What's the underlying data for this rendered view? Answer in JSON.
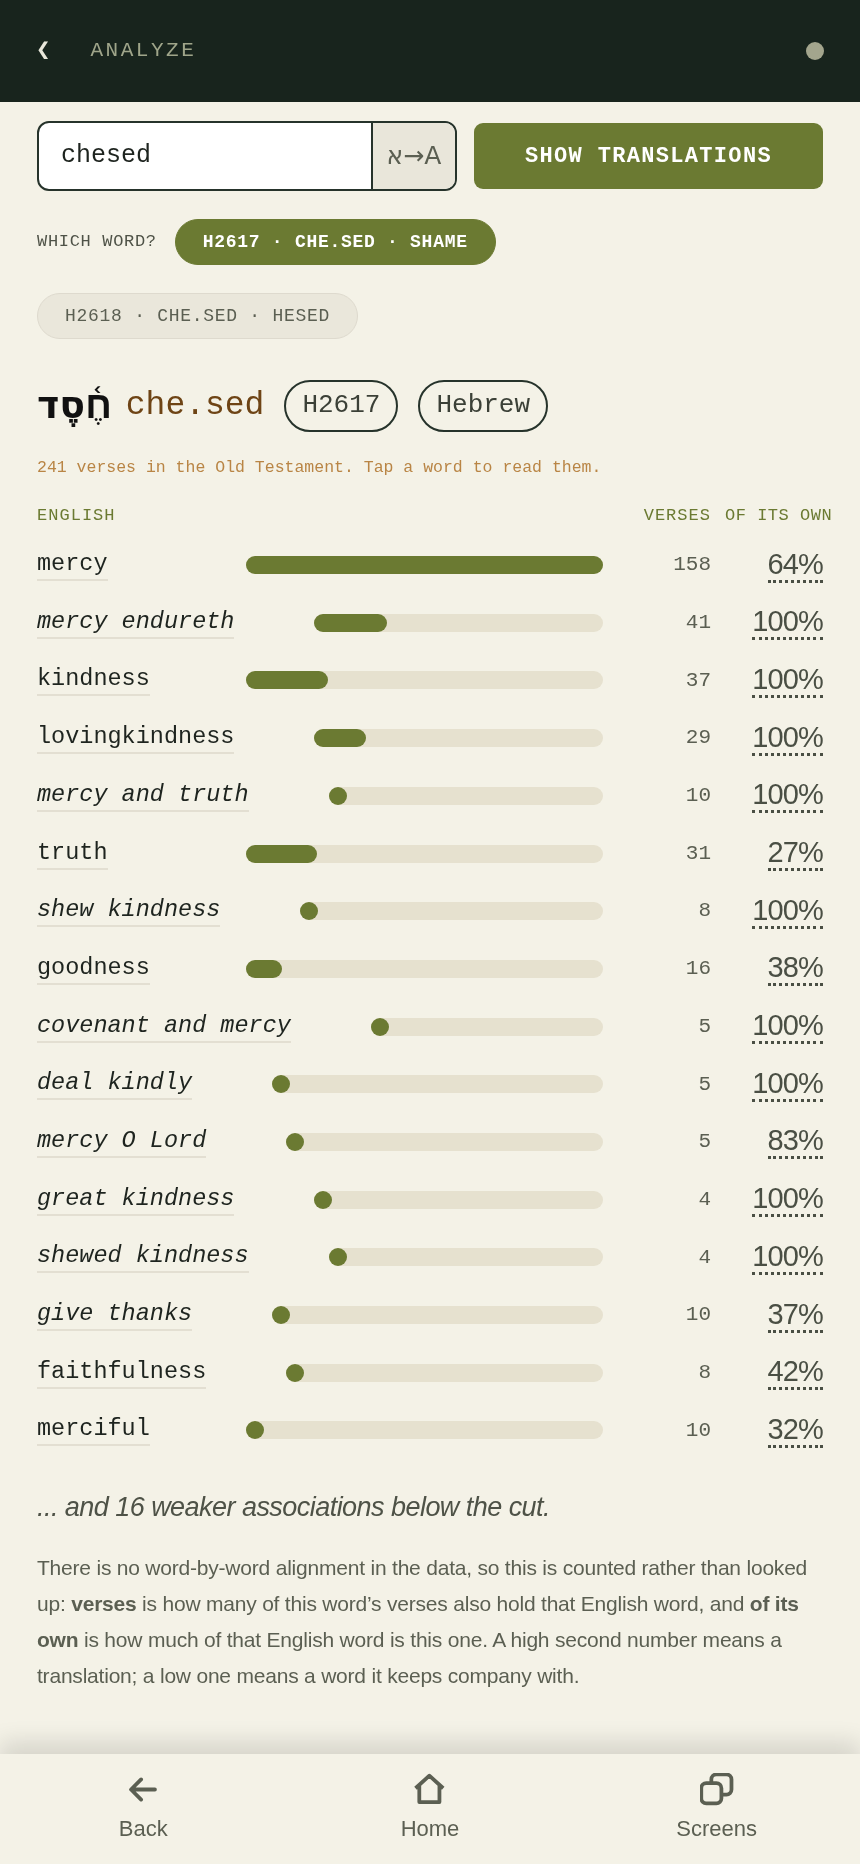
{
  "header": {
    "back": "❮",
    "title": "ANALYZE"
  },
  "search": {
    "value": "chesed",
    "toggle": "א→A",
    "button": "SHOW TRANSLATIONS"
  },
  "which_word": {
    "label": "WHICH WORD?",
    "options": [
      {
        "label": "H2617 · CHE.SED · SHAME",
        "selected": true
      },
      {
        "label": "H2618 · CHE.SED · HESED",
        "selected": false
      }
    ]
  },
  "word": {
    "hebrew": "חֶ֫סֶד",
    "transliteration": "che.sed",
    "tags": [
      "H2617",
      "Hebrew"
    ]
  },
  "summary": "241 verses in the Old Testament. Tap a word to read them.",
  "table": {
    "columns": [
      "ENGLISH",
      "VERSES",
      "OF ITS OWN"
    ],
    "rows": [
      {
        "english": "mercy",
        "kind": "word",
        "level": 1,
        "verses": "158",
        "own": "64%"
      },
      {
        "english": "mercy endureth",
        "kind": "phrase",
        "level": 0.25,
        "verses": "41",
        "own": "100%"
      },
      {
        "english": "kindness",
        "kind": "word",
        "level": 0.23,
        "verses": "37",
        "own": "100%"
      },
      {
        "english": "lovingkindness",
        "kind": "word",
        "level": 0.18,
        "verses": "29",
        "own": "100%"
      },
      {
        "english": "mercy and truth",
        "kind": "phrase",
        "level": 0.04,
        "verses": "10",
        "own": "100%"
      },
      {
        "english": "truth",
        "kind": "word",
        "level": 0.2,
        "verses": "31",
        "own": "27%"
      },
      {
        "english": "shew kindness",
        "kind": "phrase",
        "level": 0.04,
        "verses": "8",
        "own": "100%"
      },
      {
        "english": "goodness",
        "kind": "word",
        "level": 0.1,
        "verses": "16",
        "own": "38%"
      },
      {
        "english": "covenant and mercy",
        "kind": "phrase",
        "level": 0.03,
        "verses": "5",
        "own": "100%"
      },
      {
        "english": "deal kindly",
        "kind": "phrase",
        "level": 0.03,
        "verses": "5",
        "own": "100%"
      },
      {
        "english": "mercy O Lord",
        "kind": "phrase",
        "level": 0.03,
        "verses": "5",
        "own": "83%"
      },
      {
        "english": "great kindness",
        "kind": "phrase",
        "level": 0.03,
        "verses": "4",
        "own": "100%"
      },
      {
        "english": "shewed kindness",
        "kind": "phrase",
        "level": 0.03,
        "verses": "4",
        "own": "100%"
      },
      {
        "english": "give thanks",
        "kind": "phrase",
        "level": 0.05,
        "verses": "10",
        "own": "37%"
      },
      {
        "english": "faithfulness",
        "kind": "word",
        "level": 0.05,
        "verses": "8",
        "own": "42%"
      },
      {
        "english": "merciful",
        "kind": "word",
        "level": 0.05,
        "verses": "10",
        "own": "32%"
      }
    ]
  },
  "more": "... and 16 weaker associations below the cut.",
  "explanation": "There is no word-by-word alignment in the data, so this is counted rather than looked up: **verses** is how many of this word’s verses also hold that English word, and **of its own** is how much of that English word is this one. A high second number means a translation; a low one means a word it keeps company with.",
  "nav": [
    {
      "label": "Back"
    },
    {
      "label": "Home"
    },
    {
      "label": "Screens"
    }
  ]
}
